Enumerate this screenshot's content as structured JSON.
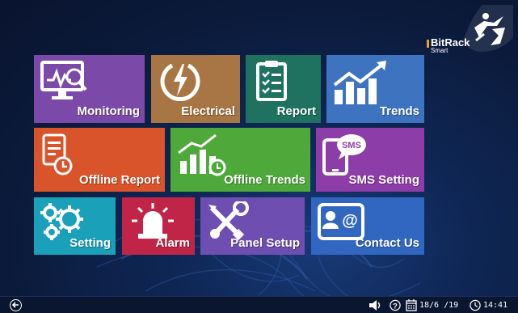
{
  "brand": {
    "name": "BitRack",
    "sub": "Smart",
    "accent": "#f0a020"
  },
  "tiles": [
    {
      "label": "Monitoring",
      "icon": "monitor-gauge-icon",
      "color": "#7b4aa8"
    },
    {
      "label": "Electrical",
      "icon": "power-bolt-icon",
      "color": "#a87644"
    },
    {
      "label": "Report",
      "icon": "clipboard-checklist-icon",
      "color": "#1f7260"
    },
    {
      "label": "Trends",
      "icon": "trend-chart-icon",
      "color": "#3e73c0"
    },
    {
      "label": "Offline Report",
      "icon": "document-clock-icon",
      "color": "#d9542a"
    },
    {
      "label": "Offline Trends",
      "icon": "bars-clock-icon",
      "color": "#4ea93a"
    },
    {
      "label": "SMS Setting",
      "icon": "sms-phone-icon",
      "color": "#8d3da8"
    },
    {
      "label": "Setting",
      "icon": "gears-icon",
      "color": "#1aa0b8"
    },
    {
      "label": "Alarm",
      "icon": "alarm-siren-icon",
      "color": "#c02548"
    },
    {
      "label": "Panel Setup",
      "icon": "tools-icon",
      "color": "#6e4eb0"
    },
    {
      "label": "Contact Us",
      "icon": "contact-card-icon",
      "color": "#3167c0"
    }
  ],
  "taskbar": {
    "back_icon": "back-arrow-icon",
    "volume_icon": "speaker-icon",
    "help_icon": "help-icon",
    "calendar_icon": "calendar-icon",
    "clock_icon": "clock-icon",
    "date": "18/6 /19",
    "time": "14:41"
  }
}
